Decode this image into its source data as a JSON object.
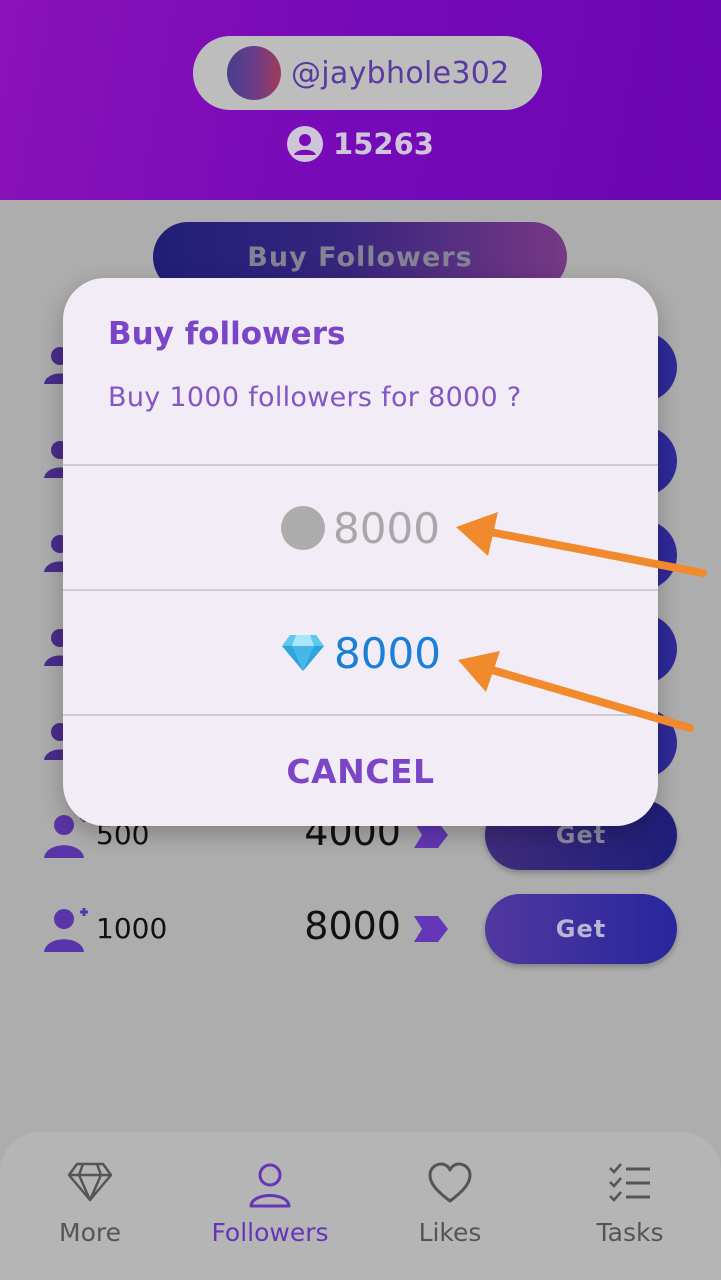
{
  "header": {
    "username": "@jaybhole302",
    "followers_count": "15263"
  },
  "banner": {
    "label": "Buy Followers"
  },
  "packages": [
    {
      "qty": "500",
      "price": "4000",
      "button": "Get"
    },
    {
      "qty": "1000",
      "price": "8000",
      "button": "Get"
    }
  ],
  "dialog": {
    "title": "Buy followers",
    "message": "Buy 1000 followers for 8000 ?",
    "coin_option": "8000",
    "gem_option": "8000",
    "cancel": "CANCEL"
  },
  "nav": {
    "items": [
      {
        "label": "More",
        "icon": "diamond-icon"
      },
      {
        "label": "Followers",
        "icon": "person-icon"
      },
      {
        "label": "Likes",
        "icon": "heart-icon"
      },
      {
        "label": "Tasks",
        "icon": "checklist-icon"
      }
    ],
    "active": "Followers"
  },
  "colors": {
    "header": "#7a0cb8",
    "accent": "#7b45c8",
    "gem": "#1a7fd6",
    "arrow": "#f08a2c"
  }
}
